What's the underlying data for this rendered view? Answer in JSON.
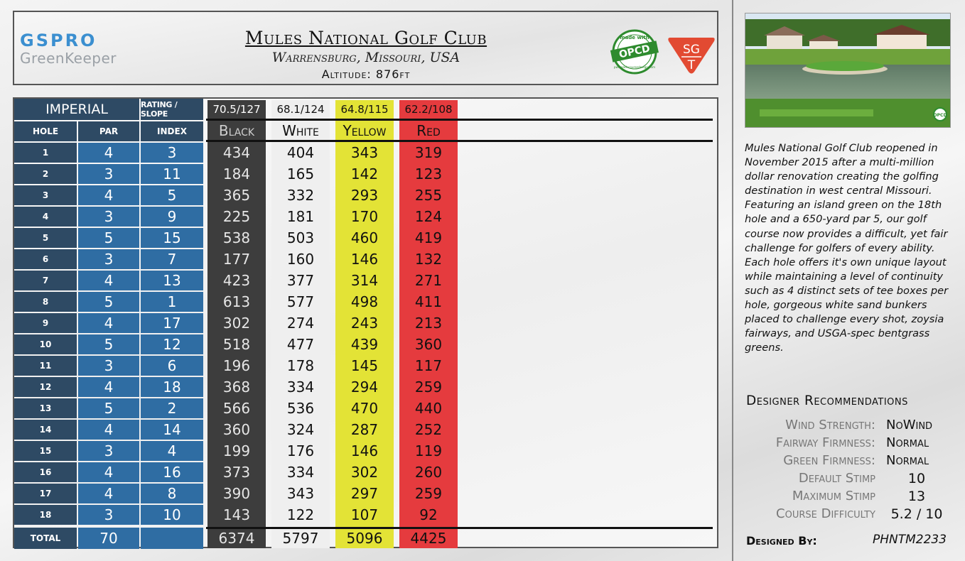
{
  "header": {
    "brand_top": "GSPRO",
    "brand_bottom": "GreenKeeper",
    "course_name": "Mules National Golf Club",
    "location": "Warrensburg, Missouri, USA",
    "altitude": "Altitude: 876ft",
    "opcd_badge": {
      "top_text": "made with",
      "main_text": "OPCD",
      "bottom_text": "pwrcoachcoursedesign.com"
    },
    "sgt_badge": {
      "top_text": "SG",
      "bottom_text": "T"
    }
  },
  "scorecard": {
    "unit_label": "IMPERIAL",
    "rating_slope_label": "RATING / SLOPE",
    "col_hole": "HOLE",
    "col_par": "PAR",
    "col_index": "INDEX",
    "total_label": "TOTAL",
    "par_total": "70",
    "tees": [
      {
        "name": "Black",
        "rating_slope": "70.5/127",
        "color": "#3d3d3d",
        "text_color": "#e6e6e6",
        "head_text": "#cfcfcf",
        "rs_bg": "#3d3d3d",
        "rs_text": "#ffffff",
        "total": "6374"
      },
      {
        "name": "White",
        "rating_slope": "68.1/124",
        "color": "#efefef",
        "text_color": "#111111",
        "head_text": "#111111",
        "rs_bg": "#efefef",
        "rs_text": "#111111",
        "total": "5797"
      },
      {
        "name": "Yellow",
        "rating_slope": "64.8/115",
        "color": "#e3e336",
        "text_color": "#111111",
        "head_text": "#111111",
        "rs_bg": "#e3e336",
        "rs_text": "#111111",
        "total": "5096"
      },
      {
        "name": "Red",
        "rating_slope": "62.2/108",
        "color": "#e53b3e",
        "text_color": "#111111",
        "head_text": "#111111",
        "rs_bg": "#e53b3e",
        "rs_text": "#111111",
        "total": "4425"
      }
    ],
    "holes": [
      {
        "hole": "1",
        "par": "4",
        "index": "3",
        "yards": [
          "434",
          "404",
          "343",
          "319"
        ]
      },
      {
        "hole": "2",
        "par": "3",
        "index": "11",
        "yards": [
          "184",
          "165",
          "142",
          "123"
        ]
      },
      {
        "hole": "3",
        "par": "4",
        "index": "5",
        "yards": [
          "365",
          "332",
          "293",
          "255"
        ]
      },
      {
        "hole": "4",
        "par": "3",
        "index": "9",
        "yards": [
          "225",
          "181",
          "170",
          "124"
        ]
      },
      {
        "hole": "5",
        "par": "5",
        "index": "15",
        "yards": [
          "538",
          "503",
          "460",
          "419"
        ]
      },
      {
        "hole": "6",
        "par": "3",
        "index": "7",
        "yards": [
          "177",
          "160",
          "146",
          "132"
        ]
      },
      {
        "hole": "7",
        "par": "4",
        "index": "13",
        "yards": [
          "423",
          "377",
          "314",
          "271"
        ]
      },
      {
        "hole": "8",
        "par": "5",
        "index": "1",
        "yards": [
          "613",
          "577",
          "498",
          "411"
        ]
      },
      {
        "hole": "9",
        "par": "4",
        "index": "17",
        "yards": [
          "302",
          "274",
          "243",
          "213"
        ]
      },
      {
        "hole": "10",
        "par": "5",
        "index": "12",
        "yards": [
          "518",
          "477",
          "439",
          "360"
        ]
      },
      {
        "hole": "11",
        "par": "3",
        "index": "6",
        "yards": [
          "196",
          "178",
          "145",
          "117"
        ]
      },
      {
        "hole": "12",
        "par": "4",
        "index": "18",
        "yards": [
          "368",
          "334",
          "294",
          "259"
        ]
      },
      {
        "hole": "13",
        "par": "5",
        "index": "2",
        "yards": [
          "566",
          "536",
          "470",
          "440"
        ]
      },
      {
        "hole": "14",
        "par": "4",
        "index": "14",
        "yards": [
          "360",
          "324",
          "287",
          "252"
        ]
      },
      {
        "hole": "15",
        "par": "3",
        "index": "4",
        "yards": [
          "199",
          "176",
          "146",
          "119"
        ]
      },
      {
        "hole": "16",
        "par": "4",
        "index": "16",
        "yards": [
          "373",
          "334",
          "302",
          "260"
        ]
      },
      {
        "hole": "17",
        "par": "4",
        "index": "8",
        "yards": [
          "390",
          "343",
          "297",
          "259"
        ]
      },
      {
        "hole": "18",
        "par": "3",
        "index": "10",
        "yards": [
          "143",
          "122",
          "107",
          "92"
        ]
      }
    ]
  },
  "sidebar": {
    "photo_badge": "OPCD",
    "description": "Mules National Golf Club reopened in November 2015 after a multi-million dollar renovation creating the golfing destination in west central Missouri. Featuring an island green on the 18th hole and a 650-yard par 5, our golf course now provides a difficult, yet fair challenge for golfers of every ability. Each hole offers it's own unique layout while maintaining a level of continuity such as 4 distinct sets of tee boxes per hole, gorgeous white sand bunkers placed to challenge every shot, zoysia fairways, and USGA-spec bentgrass greens.",
    "designer_title": "Designer Recommendations",
    "recommendations": [
      {
        "label": "Wind Strength:",
        "value": "NoWind"
      },
      {
        "label": "Fairway Firmness:",
        "value": "Normal"
      },
      {
        "label": "Green Firmness:",
        "value": "Normal"
      },
      {
        "label": "Default Stimp",
        "value": "10"
      },
      {
        "label": "Maximum Stimp",
        "value": "13"
      },
      {
        "label": "Course Difficulty",
        "value": "5.2 / 10"
      }
    ],
    "designed_by_label": "Designed By:",
    "designed_by_value": "PHNTM2233"
  }
}
